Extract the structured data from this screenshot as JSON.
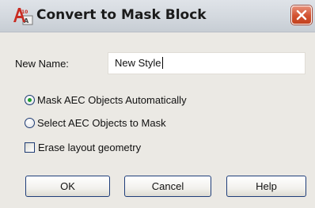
{
  "window": {
    "title": "Convert to Mask Block",
    "icon": "autocad-app-icon",
    "close_icon": "close-icon",
    "close_color": "#d2512f"
  },
  "form": {
    "name_label": "New Name:",
    "name_value": "New Style",
    "radio_auto": {
      "label": "Mask AEC Objects Automatically",
      "selected": true
    },
    "radio_select": {
      "label": "Select AEC Objects to Mask",
      "selected": false
    },
    "erase_checkbox": {
      "label": "Erase layout geometry",
      "checked": false
    }
  },
  "buttons": {
    "ok": "OK",
    "cancel": "Cancel",
    "help": "Help"
  }
}
